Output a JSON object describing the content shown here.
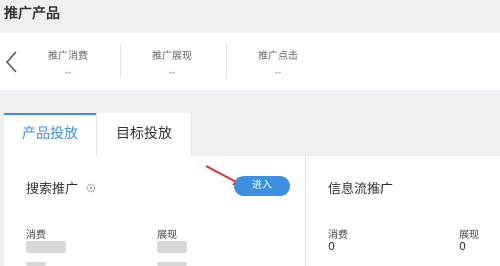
{
  "page": {
    "title": "推广产品"
  },
  "stats": [
    {
      "label": "推广消费",
      "value": "--"
    },
    {
      "label": "推广展现",
      "value": "--"
    },
    {
      "label": "推广点击",
      "value": "--"
    }
  ],
  "tabs": [
    {
      "label": "产品投放",
      "active": true
    },
    {
      "label": "目标投放",
      "active": false
    }
  ],
  "search_panel": {
    "title": "搜索推广",
    "enter_label": "进入",
    "metrics": [
      {
        "label": "消费"
      },
      {
        "label": "展现"
      }
    ]
  },
  "feed_panel": {
    "title": "信息流推广",
    "metrics": [
      {
        "label": "消费",
        "value": "0"
      },
      {
        "label": "展现",
        "value": "0"
      }
    ]
  },
  "colors": {
    "accent": "#3d8fe0",
    "annotation_arrow": "#e0302a",
    "dash_value": "#e0504a"
  }
}
